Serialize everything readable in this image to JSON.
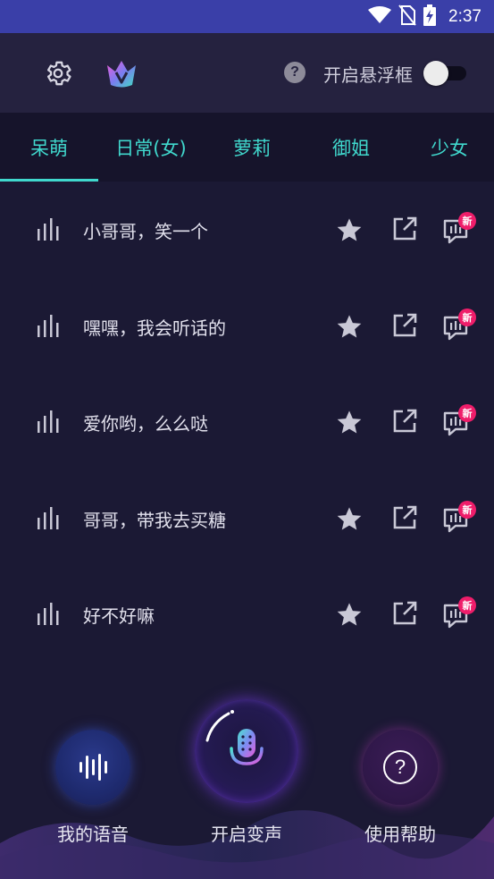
{
  "status_bar": {
    "time": "2:37",
    "icons": [
      "wifi-icon",
      "no-sim-icon",
      "battery-charging-icon"
    ]
  },
  "header": {
    "settings_icon": "gear-icon",
    "vip_icon": "vip-crown-icon",
    "help_icon_glyph": "?",
    "float_window_label": "开启悬浮框",
    "float_window_enabled": false
  },
  "tabs": {
    "selected_index": 0,
    "items": [
      {
        "label": "呆萌"
      },
      {
        "label": "日常(女)"
      },
      {
        "label": "萝莉"
      },
      {
        "label": "御姐"
      },
      {
        "label": "少女"
      }
    ]
  },
  "voice_list": {
    "new_badge": "新",
    "items": [
      {
        "text": "小哥哥，笑一个"
      },
      {
        "text": "嘿嘿，我会听话的"
      },
      {
        "text": "爱你哟，么么哒"
      },
      {
        "text": "哥哥，带我去买糖"
      },
      {
        "text": "好不好嘛"
      }
    ]
  },
  "bottom": {
    "my_voice_label": "我的语音",
    "start_voice_change_label": "开启变声",
    "help_label": "使用帮助",
    "help_glyph": "?"
  },
  "colors": {
    "background": "#1b1934",
    "header": "#25223f",
    "tabs_bg": "#16142b",
    "accent": "#40d8cd",
    "badge": "#ef1d6a",
    "status_bar": "#3a3fa8"
  }
}
